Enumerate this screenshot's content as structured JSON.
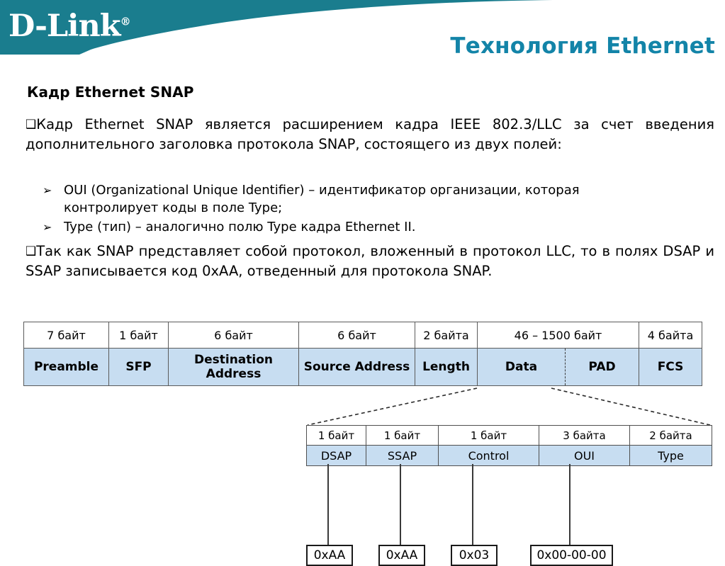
{
  "header": {
    "logo_text": "D-Link",
    "logo_registered": "®",
    "title": "Технология Ethernet",
    "brand_color": "#1a7d8e",
    "title_color": "#1384a8"
  },
  "slide": {
    "subtitle": "Кадр Ethernet SNAP",
    "bullet_glyph": "❑",
    "arrow_glyph": "➢",
    "paragraphs": [
      "Кадр Ethernet SNAP является расширением кадра IEEE 802.3/LLC за счет введения дополнительного заголовка протокола SNAP, состоящего из двух полей:",
      "Так как SNAP представляет собой протокол, вложенный в протокол LLC, то в полях DSAP и SSAP записывается код 0xAA, отведенный для протокола SNAP."
    ],
    "sub_items": [
      {
        "line1": "OUI (Organizational Unique Identifier) – идентификатор организации, которая",
        "line2": "контролирует коды в поле Type;"
      },
      {
        "line1": "Type (тип) – аналогично полю Type кадра Ethernet II.",
        "line2": ""
      }
    ]
  },
  "frame_table": {
    "sizes": [
      "7 байт",
      "1 байт",
      "6 байт",
      "6 байт",
      "2 байта",
      "46 – 1500 байт",
      "4 байта"
    ],
    "names": [
      "Preamble",
      "SFP",
      "Destination Address",
      "Source Address",
      "Length",
      "Data",
      "PAD",
      "FCS"
    ],
    "header_bg": "#ffffff",
    "row_bg": "#c7ddf1"
  },
  "snap_table": {
    "sizes": [
      "1 байт",
      "1 байт",
      "1 байт",
      "3 байта",
      "2 байта"
    ],
    "names": [
      "DSAP",
      "SSAP",
      "Control",
      "OUI",
      "Type"
    ],
    "row_bg": "#c7ddf1"
  },
  "value_boxes": [
    {
      "label": "0xAA"
    },
    {
      "label": "0xAA"
    },
    {
      "label": "0x03"
    },
    {
      "label": "0x00-00-00"
    }
  ]
}
